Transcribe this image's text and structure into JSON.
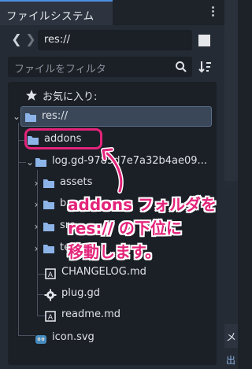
{
  "dock": {
    "tab_label": "ファイルシステム",
    "path_value": "res://",
    "filter_placeholder": "ファイルをフィルタ"
  },
  "tree": {
    "favorites_label": "お気に入り:",
    "root_label": "res://",
    "items": [
      {
        "label": "addons",
        "type": "folder"
      },
      {
        "label": "log.gd-9785d7e7a32b4ae09...",
        "type": "folder"
      },
      {
        "label": "assets",
        "type": "folder"
      },
      {
        "label": "b",
        "type": "folder"
      },
      {
        "label": "src",
        "type": "folder"
      },
      {
        "label": "test",
        "type": "folder"
      },
      {
        "label": "CHANGELOG.md",
        "type": "file-md"
      },
      {
        "label": "plug.gd",
        "type": "file-gd"
      },
      {
        "label": "readme.md",
        "type": "file-md"
      },
      {
        "label": "icon.svg",
        "type": "file-svg"
      }
    ]
  },
  "annotation": {
    "lines": [
      "addons フォルダを",
      "res:// の下位に",
      "移動します。"
    ],
    "color": "#e3247a"
  },
  "right_strip": {
    "label_1": "メ",
    "label_2": "出"
  }
}
